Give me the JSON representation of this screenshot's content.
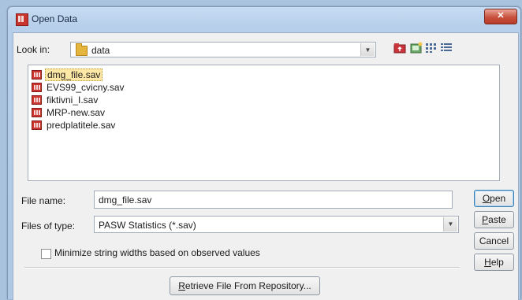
{
  "window": {
    "title": "Open Data"
  },
  "look_in": {
    "label": "Look in:",
    "value": "data"
  },
  "toolbar_icons": [
    "up-folder-icon",
    "new-folder-icon",
    "list-view-icon",
    "details-view-icon"
  ],
  "files": [
    {
      "name": "dmg_file.sav",
      "selected": true
    },
    {
      "name": "EVS99_cvicny.sav"
    },
    {
      "name": "fiktivni_I.sav"
    },
    {
      "name": "MRP-new.sav"
    },
    {
      "name": "predplatitele.sav"
    }
  ],
  "file_name": {
    "label": "File name:",
    "value": "dmg_file.sav"
  },
  "file_type": {
    "label": "Files of type:",
    "value": "PASW Statistics (*.sav)"
  },
  "buttons": {
    "open": {
      "pre": "",
      "u": "O",
      "post": "pen"
    },
    "paste": {
      "pre": "",
      "u": "P",
      "post": "aste"
    },
    "cancel": {
      "pre": "Cancel",
      "u": "",
      "post": ""
    },
    "help": {
      "pre": "",
      "u": "H",
      "post": "elp"
    }
  },
  "minimize": {
    "label": "Minimize string widths based on observed values",
    "checked": false
  },
  "retrieve": {
    "pre": "",
    "u": "R",
    "post": "etrieve File From Repository..."
  }
}
